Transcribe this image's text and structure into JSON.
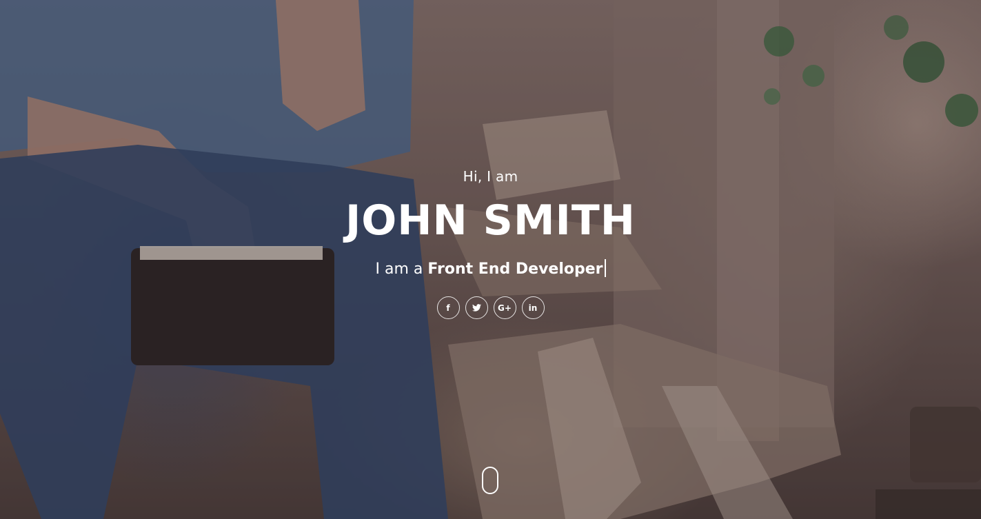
{
  "hero": {
    "greeting": "Hi, I am",
    "name": "JOHN SMITH",
    "tagline_prefix": "I am a",
    "tagline_role": "Front End Developer"
  },
  "social": [
    {
      "label": "f",
      "icon": "facebook-icon"
    },
    {
      "label": "t",
      "icon": "twitter-icon"
    },
    {
      "label": "G+",
      "icon": "google-plus-icon"
    },
    {
      "label": "in",
      "icon": "linkedin-icon"
    }
  ],
  "scroll": {
    "icon": "mouse-scroll-icon"
  },
  "colors": {
    "text": "#ffffff",
    "overlay": "#281c1e"
  }
}
